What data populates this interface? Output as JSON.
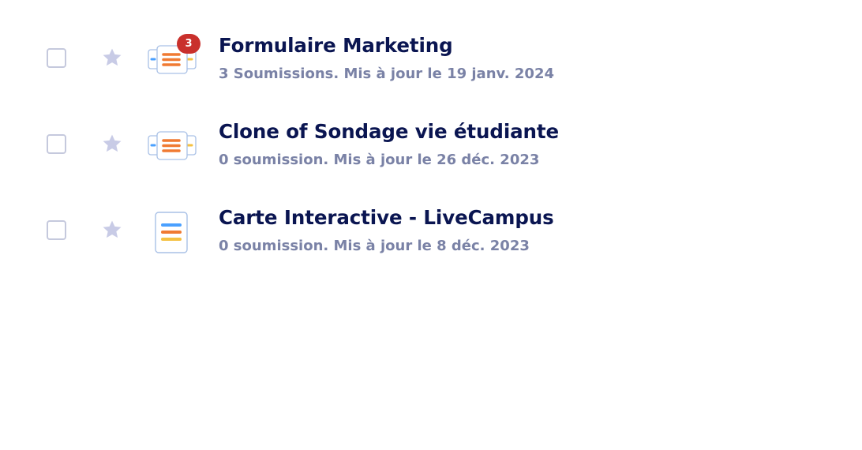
{
  "colors": {
    "title": "#0a1551",
    "meta": "#7a82a6",
    "checkbox_border": "#c5c9dd",
    "star": "#c8cbe6",
    "badge": "#c9302c",
    "card_border": "#a9c1e6",
    "line_blue": "#4aa0ff",
    "line_orange": "#f07a32",
    "line_yellow": "#f5c142"
  },
  "forms": [
    {
      "title": "Formulaire Marketing",
      "meta": "3 Soumissions. Mis à jour le 19 janv. 2024",
      "icon": "card-form-icon",
      "badge": "3"
    },
    {
      "title": "Clone of Sondage vie étudiante",
      "meta": "0 soumission. Mis à jour le 26 déc. 2023",
      "icon": "card-form-icon"
    },
    {
      "title": "Carte Interactive - LiveCampus",
      "meta": "0 soumission. Mis à jour le 8 déc. 2023",
      "icon": "classic-form-icon"
    }
  ]
}
